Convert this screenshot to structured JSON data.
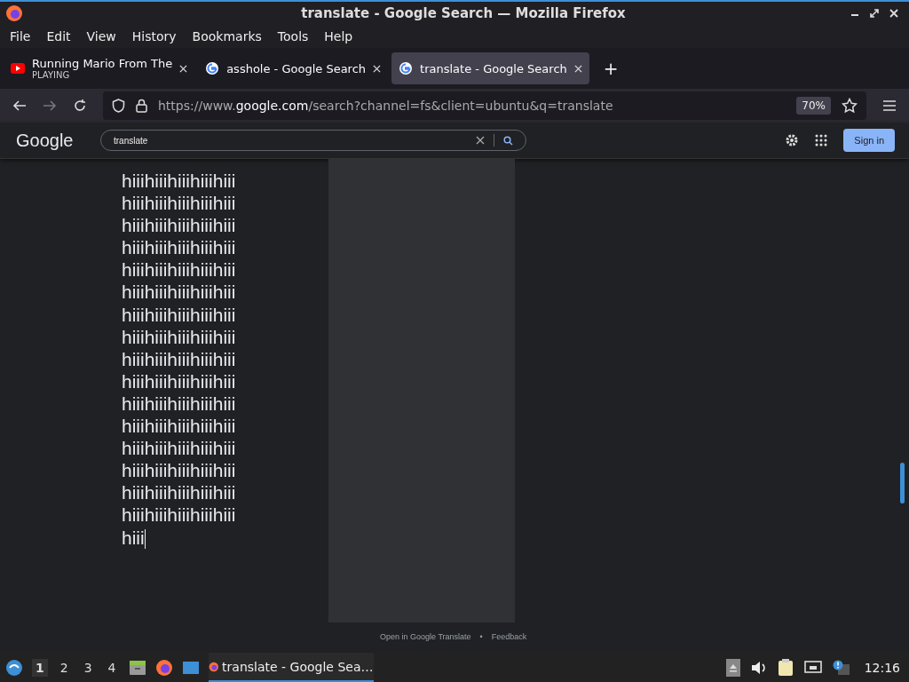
{
  "window": {
    "title": "translate - Google Search — Mozilla Firefox"
  },
  "menu": [
    "File",
    "Edit",
    "View",
    "History",
    "Bookmarks",
    "Tools",
    "Help"
  ],
  "tabs": [
    {
      "title": "Running Mario From The",
      "subtitle": "PLAYING",
      "kind": "video",
      "selected": false
    },
    {
      "title": "asshole - Google Search",
      "kind": "google",
      "selected": false
    },
    {
      "title": "translate - Google Search",
      "kind": "google",
      "selected": true
    }
  ],
  "new_tab": "+",
  "address": {
    "prefix": "https://www.",
    "domain": "google.com",
    "path": "/search?channel=fs&client=ubuntu&q=translate",
    "zoom": "70%"
  },
  "google": {
    "logo": "Google",
    "query": "translate",
    "sign_in": "Sign in"
  },
  "source_lines": [
    "hiiihiiihiiihiiihiii",
    "hiiihiiihiiihiiihiii",
    "hiiihiiihiiihiiihiii",
    "hiiihiiihiiihiiihiii",
    "hiiihiiihiiihiiihiii",
    "hiiihiiihiiihiiihiii",
    "hiiihiiihiiihiiihiii",
    "hiiihiiihiiihiiihiii",
    "hiiihiiihiiihiiihiii",
    "hiiihiiihiiihiiihiii",
    "hiiihiiihiiihiiihiii",
    "hiiihiiihiiihiiihiii",
    "hiiihiiihiiihiiihiii",
    "hiiihiiihiiihiiihiii",
    "hiiihiiihiiihiiihiii",
    "hiiihiiihiiihiiihiii",
    "hiii"
  ],
  "footer": {
    "link": "Open in Google Translate",
    "separator": "•",
    "feedback": "Feedback"
  },
  "taskbar": {
    "workspaces": [
      {
        "label": "1",
        "selected": true
      },
      {
        "label": "2",
        "selected": false
      },
      {
        "label": "3",
        "selected": false
      },
      {
        "label": "4",
        "selected": false
      }
    ],
    "task": "translate - Google Sea…",
    "clock": "12:16"
  }
}
